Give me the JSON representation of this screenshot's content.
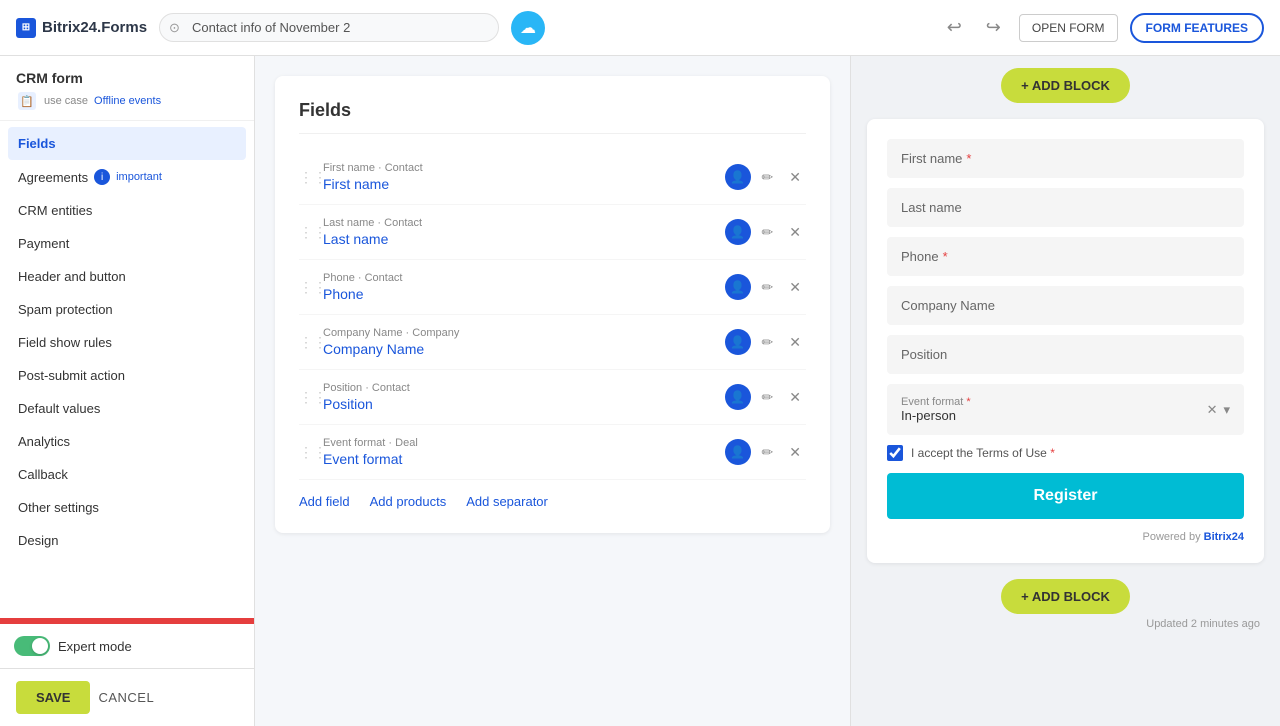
{
  "topbar": {
    "logo": "Bitrix24.Forms",
    "form_name": "Contact info of November 2",
    "btn_open": "OPEN FORM",
    "btn_features": "FORM FEATURES"
  },
  "left_panel": {
    "crm_form_title": "CRM form",
    "use_case_label": "use case",
    "use_case_link": "Offline events",
    "nav_items": [
      {
        "label": "Fields",
        "active": true
      },
      {
        "label": "Agreements",
        "badge": "important"
      },
      {
        "label": "CRM entities"
      },
      {
        "label": "Payment"
      },
      {
        "label": "Header and button"
      },
      {
        "label": "Spam protection"
      },
      {
        "label": "Field show rules"
      },
      {
        "label": "Post-submit action"
      },
      {
        "label": "Default values"
      },
      {
        "label": "Analytics"
      },
      {
        "label": "Callback"
      },
      {
        "label": "Other settings"
      },
      {
        "label": "Design"
      }
    ],
    "expert_mode_label": "Expert mode",
    "btn_save": "SAVE",
    "btn_cancel": "CANCEL"
  },
  "fields_panel": {
    "title": "Fields",
    "fields": [
      {
        "entity": "First name · Contact",
        "name": "First name"
      },
      {
        "entity": "Last name · Contact",
        "name": "Last name"
      },
      {
        "entity": "Phone · Contact",
        "name": "Phone"
      },
      {
        "entity": "Company Name · Company",
        "name": "Company Name"
      },
      {
        "entity": "Position · Contact",
        "name": "Position"
      },
      {
        "entity": "Event format · Deal",
        "name": "Event format"
      }
    ],
    "add_field": "Add field",
    "add_products": "Add products",
    "add_separator": "Add separator"
  },
  "form_preview": {
    "add_block_label": "+ ADD BLOCK",
    "fields": [
      {
        "label": "First name",
        "required": true
      },
      {
        "label": "Last name",
        "required": false
      },
      {
        "label": "Phone",
        "required": true
      },
      {
        "label": "Company Name",
        "required": false
      },
      {
        "label": "Position",
        "required": false
      }
    ],
    "dropdown_label": "Event format",
    "dropdown_req": true,
    "dropdown_value": "In-person",
    "terms_text": "I accept the Terms of Use",
    "terms_req": true,
    "btn_register": "Register",
    "powered_by": "Powered by ",
    "powered_brand": "Bitrix24",
    "updated_text": "Updated 2 minutes ago"
  }
}
